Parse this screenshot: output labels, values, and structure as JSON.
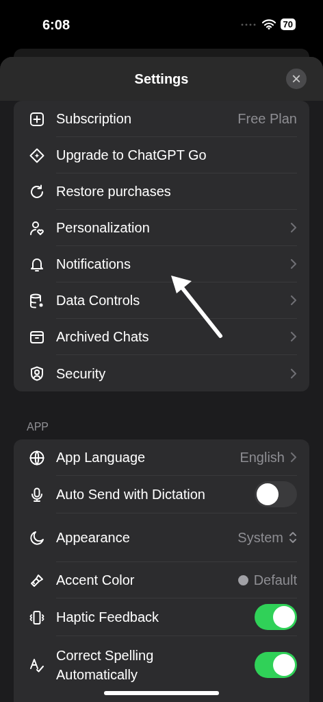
{
  "status_bar": {
    "time": "6:08",
    "battery": "70"
  },
  "sheet": {
    "title": "Settings",
    "close": "×"
  },
  "account": {
    "items": [
      {
        "label": "Subscription",
        "value": "Free Plan",
        "chevron": false
      },
      {
        "label": "Upgrade to ChatGPT Go",
        "chevron": false
      },
      {
        "label": "Restore purchases",
        "chevron": false
      },
      {
        "label": "Personalization",
        "chevron": true
      },
      {
        "label": "Notifications",
        "chevron": true
      },
      {
        "label": "Data Controls",
        "chevron": true
      },
      {
        "label": "Archived Chats",
        "chevron": true
      },
      {
        "label": "Security",
        "chevron": true
      }
    ]
  },
  "app": {
    "heading": "APP",
    "items": [
      {
        "label": "App Language",
        "value": "English",
        "chevron": true
      },
      {
        "kind": "toggle",
        "label": "Auto Send with Dictation",
        "on": false
      },
      {
        "kind": "picker",
        "label": "Appearance",
        "value": "System"
      },
      {
        "kind": "color",
        "label": "Accent Color",
        "value": "Default",
        "color": "#a1a1a6"
      },
      {
        "kind": "toggle",
        "label": "Haptic Feedback",
        "on": true
      },
      {
        "kind": "toggle",
        "label": "Correct Spelling Automatically",
        "on": true
      }
    ]
  }
}
